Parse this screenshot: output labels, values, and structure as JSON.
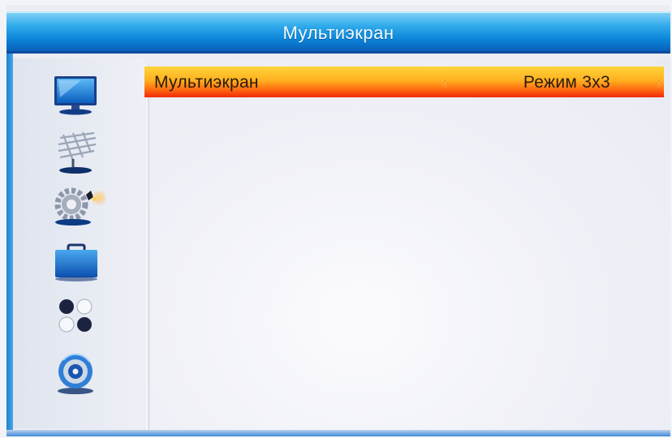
{
  "header": {
    "title": "Мультиэкран"
  },
  "sidebar": {
    "items": [
      {
        "icon": "tv-icon"
      },
      {
        "icon": "satellite-dish-icon"
      },
      {
        "icon": "settings-gear-icon"
      },
      {
        "icon": "toolbox-icon"
      },
      {
        "icon": "games-icon"
      },
      {
        "icon": "media-player-icon"
      }
    ],
    "selected_index": 2
  },
  "menu": {
    "rows": [
      {
        "label": "Мультиэкран",
        "value": "Режим 3x3",
        "left_arrow": "‹",
        "right_arrow": "›"
      }
    ]
  },
  "colors": {
    "header_blue": "#0b84d8",
    "highlight_yellow": "#ffd43a",
    "highlight_red": "#f02808",
    "background": "#ecedf3"
  }
}
